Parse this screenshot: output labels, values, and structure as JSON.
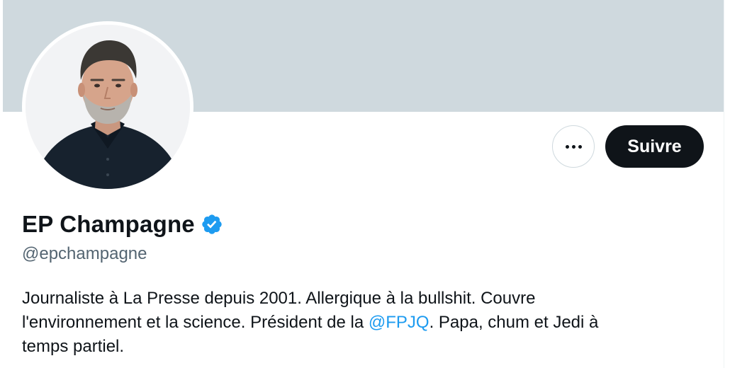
{
  "profile": {
    "display_name": "EP Champagne",
    "handle": "@epchampagne",
    "verified": true,
    "verified_icon": "verified-badge-icon",
    "avatar_alt": "Photo de profil",
    "bio": {
      "line_1": "Journaliste à La Presse depuis 2001. Allergique à la bullshit. Couvre",
      "line_2_before": "l'environnement et la science. Président de la ",
      "mention": "@FPJQ",
      "line_2_after": ". Papa, chum et Jedi à",
      "line_3": "temps partiel."
    }
  },
  "actions": {
    "more_icon": "more-options-icon",
    "follow_label": "Suivre"
  },
  "colors": {
    "banner": "#cfd9de",
    "text_primary": "#0f1419",
    "text_secondary": "#536471",
    "link": "#1d9bf0",
    "verified": "#1d9bf0",
    "follow_button_bg": "#0f1419",
    "follow_button_text": "#ffffff"
  }
}
